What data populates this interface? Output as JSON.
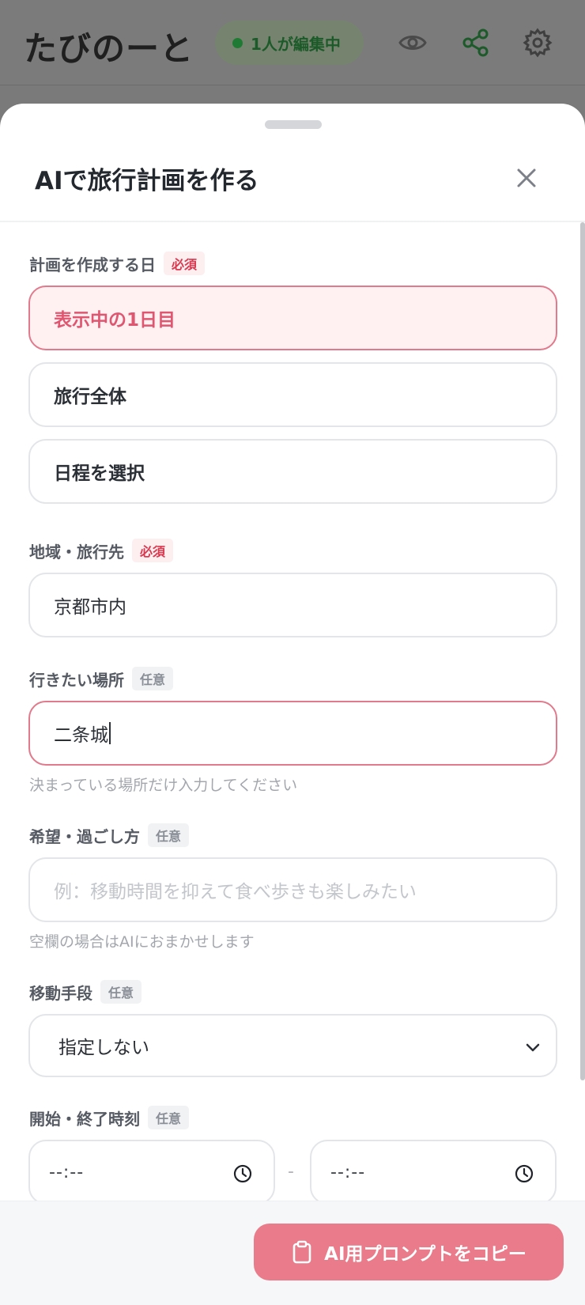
{
  "app": {
    "title": "たびのーと",
    "editing_status": "1人が編集中",
    "status_color": "#1f7a33",
    "icons": [
      "eye-icon",
      "share-icon",
      "gear-icon"
    ]
  },
  "sheet": {
    "title": "AIで旅行計画を作る",
    "close_icon": "close-icon",
    "accent_color": "#ea7b8a"
  },
  "form": {
    "date_scope": {
      "label": "計画を作成する日",
      "tag": "必須",
      "options": [
        {
          "label": "表示中の1日目",
          "selected": true
        },
        {
          "label": "旅行全体",
          "selected": false
        },
        {
          "label": "日程を選択",
          "selected": false
        }
      ]
    },
    "destination": {
      "label": "地域・旅行先",
      "tag": "必須",
      "value": "京都市内"
    },
    "places": {
      "label": "行きたい場所",
      "tag": "任意",
      "value": "二条城",
      "helper": "決まっている場所だけ入力してください"
    },
    "preferences": {
      "label": "希望・過ごし方",
      "tag": "任意",
      "value": "",
      "placeholder": "例：移動時間を抑えて食べ歩きも楽しみたい",
      "helper": "空欄の場合はAIにおまかせします"
    },
    "transport": {
      "label": "移動手段",
      "tag": "任意",
      "selected": "指定しない"
    },
    "time_range": {
      "label": "開始・終了時刻",
      "tag": "任意",
      "start": "--:--",
      "separator": "-",
      "end": "--:--"
    }
  },
  "footer": {
    "copy_button_label": "AI用プロンプトをコピー",
    "copy_icon": "clipboard-icon"
  }
}
